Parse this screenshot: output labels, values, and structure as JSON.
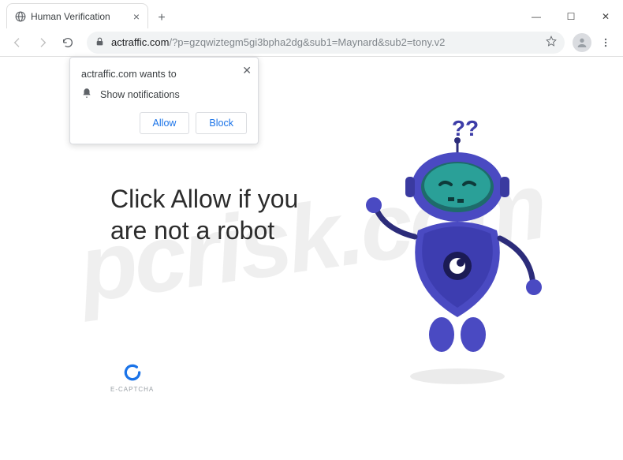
{
  "window": {
    "minimize": "—",
    "maximize": "☐",
    "close": "✕"
  },
  "tab": {
    "title": "Human Verification",
    "newtab_glyph": "+"
  },
  "toolbar": {
    "url_domain": "actraffic.com",
    "url_path": "/?p=gzqwiztegm5gi3bpha2dg&sub1=Maynard&sub2=tony.v2"
  },
  "permission": {
    "origin": "actraffic.com wants to",
    "request": "Show notifications",
    "allow": "Allow",
    "block": "Block",
    "close": "✕"
  },
  "page": {
    "headline": "Click Allow if you are not a robot",
    "captcha_label": "E-CAPTCHA",
    "questions": "??"
  }
}
